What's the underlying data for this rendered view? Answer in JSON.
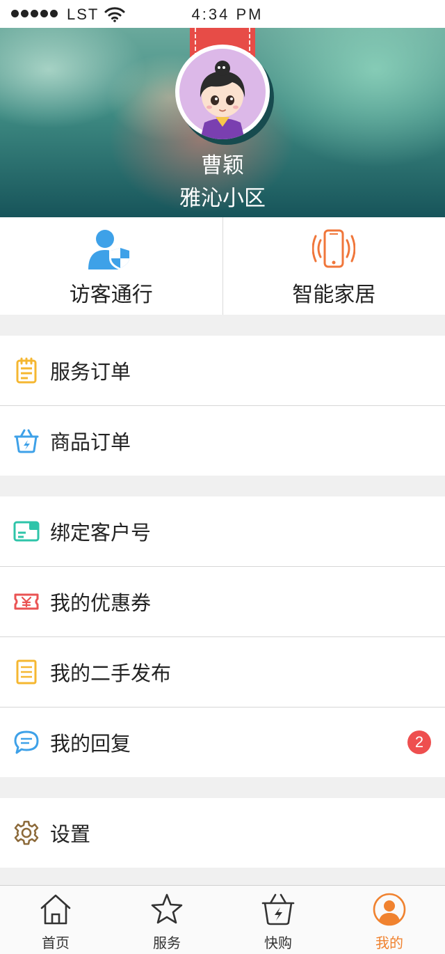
{
  "status_bar": {
    "carrier": "LST",
    "time": "4:34 PM"
  },
  "profile": {
    "name": "曹颖",
    "community": "雅沁小区"
  },
  "quick_actions": [
    {
      "label": "访客通行",
      "icon": "visitor-shield-icon",
      "color": "#3ea1e8"
    },
    {
      "label": "智能家居",
      "icon": "smartphone-signal-icon",
      "color": "#f0763a"
    }
  ],
  "menu_groups": [
    [
      {
        "label": "服务订单",
        "icon": "notepad-icon",
        "color": "#f5b731"
      },
      {
        "label": "商品订单",
        "icon": "basket-icon",
        "color": "#3ea1e8"
      }
    ],
    [
      {
        "label": "绑定客户号",
        "icon": "card-icon",
        "color": "#2ec4a9"
      },
      {
        "label": "我的优惠券",
        "icon": "coupon-icon",
        "color": "#ea5353"
      },
      {
        "label": "我的二手发布",
        "icon": "document-icon",
        "color": "#f5b731"
      },
      {
        "label": "我的回复",
        "icon": "chat-bubble-icon",
        "color": "#3ea1e8",
        "badge": "2"
      }
    ],
    [
      {
        "label": "设置",
        "icon": "gear-icon",
        "color": "#8c6a3a"
      }
    ]
  ],
  "tab_bar": {
    "active_color": "#f0822f",
    "tabs": [
      {
        "label": "首页",
        "icon": "home-icon"
      },
      {
        "label": "服务",
        "icon": "star-icon"
      },
      {
        "label": "快购",
        "icon": "basket-icon"
      },
      {
        "label": "我的",
        "icon": "user-avatar-icon",
        "active": true
      }
    ]
  }
}
